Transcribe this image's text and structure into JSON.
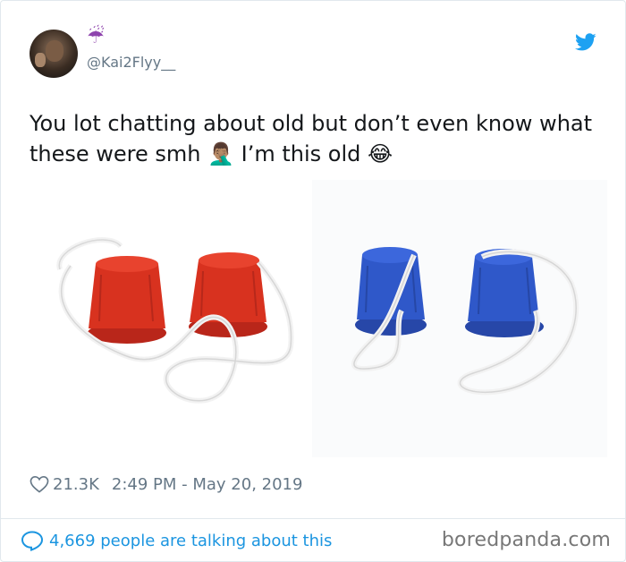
{
  "tweet": {
    "display_name_emoji": "☔",
    "handle": "@Kai2Flyy__",
    "text": "You lot chatting about old but don’t even know what these were smh 🤦🏽‍♂️ I’m this old 😂",
    "likes": "21.3K",
    "timestamp": "2:49 PM - May 20, 2019",
    "talking": "4,669 people are talking about this"
  },
  "watermark": "boredpanda.com",
  "icons": {
    "twitter": "twitter-bird-icon",
    "heart": "heart-icon",
    "comment": "speech-bubble-icon"
  },
  "colors": {
    "twitter_blue": "#1da1f2",
    "link_blue": "#1b95e0",
    "meta_gray": "#657786",
    "red_stilt": "#d8321f",
    "blue_stilt": "#2f58c9"
  }
}
